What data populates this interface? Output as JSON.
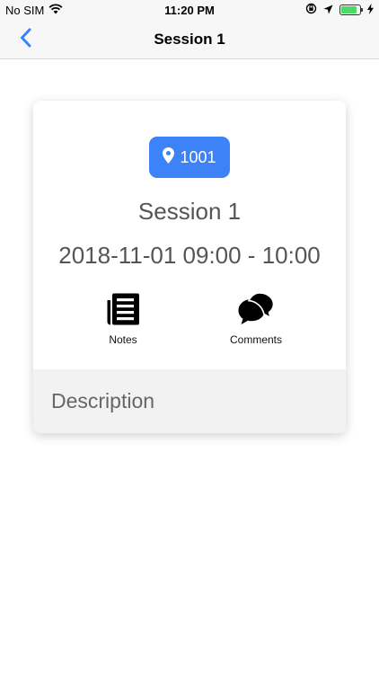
{
  "status_bar": {
    "carrier": "No SIM",
    "time": "11:20 PM",
    "battery_level": 0.85
  },
  "nav": {
    "title": "Session 1",
    "back_icon": "chevron-left-icon"
  },
  "session": {
    "room": "1001",
    "name": "Session 1",
    "time_range": "2018-11-01 09:00 - 10:00",
    "actions": [
      {
        "label": "Notes",
        "icon": "notes-icon"
      },
      {
        "label": "Comments",
        "icon": "comments-icon"
      }
    ],
    "description_label": "Description"
  },
  "colors": {
    "accent": "#3d82f7",
    "text_secondary": "#555555",
    "description_bg": "#f2f2f2"
  }
}
